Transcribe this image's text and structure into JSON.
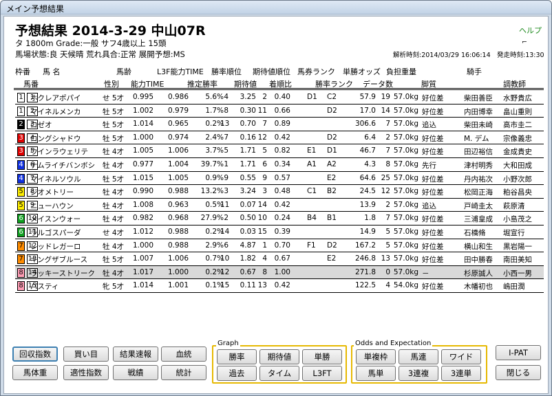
{
  "window": {
    "title": "メイン予想結果"
  },
  "header": {
    "title": "予想結果 2014-3-29 中山07R",
    "race_info": "タ 1800m  Grade:一般  サフ4歳以上  15頭",
    "conditions": "馬場状態:良    天候晴    荒れ具合:正常    展開予想:MS",
    "help": "ヘルプ",
    "analysis_time": "解析時刻:2014/03/29 16:06:14",
    "post_time": "発走時刻:13:30",
    "corner_icon": "⌐"
  },
  "columns_row1": {
    "waku": "枠番",
    "horse": "馬  名",
    "weight_label": "馬齢",
    "l3f": "L3F能力TIME",
    "win_rank": "勝率順位",
    "exp_rank": "期待値順位",
    "ticket_rank": "馬券ランク",
    "win_odds": "単勝オッズ",
    "burden": "負担重量",
    "jockey": "騎手"
  },
  "columns_row2": {
    "umaban": "馬番",
    "sex": "性別",
    "ability": "能力TIME",
    "est_win": "推定勝率",
    "expect": "期待値",
    "finish": "着順比",
    "win_rank2": "勝率ランク",
    "data_count": "データ数",
    "style": "脚質",
    "trainer": "調教師"
  },
  "rows": [
    {
      "waku": "1",
      "uma": "1",
      "name": "ホクレアポパイ",
      "sex": "せ 5才",
      "a1": "0.995",
      "a2": "0.986",
      "rate": "5.6%",
      "r1": "4",
      "exp": "3.25",
      "r2": "2",
      "fin": "0.40",
      "rk1": "D1",
      "rk2": "C2",
      "odds": "57.9",
      "cnt": "19",
      "wt": "57.0kg",
      "style": "好位差",
      "jockey": "柴田善臣",
      "trainer": "水野貴広"
    },
    {
      "waku": "1",
      "uma": "2",
      "name": "マイネルメンカ",
      "sex": "牡 5才",
      "a1": "1.002",
      "a2": "0.979",
      "rate": "1.7%",
      "r1": "8",
      "exp": "0.30",
      "r2": "11",
      "fin": "0.66",
      "rk1": "",
      "rk2": "D2",
      "odds": "17.0",
      "cnt": "14",
      "wt": "57.0kg",
      "style": "好位差",
      "jockey": "内田博幸",
      "trainer": "畠山重則"
    },
    {
      "waku": "2",
      "uma": "3",
      "name": "ロゼオ",
      "sex": "牡 5才",
      "a1": "1.014",
      "a2": "0.965",
      "rate": "0.2%",
      "r1": "13",
      "exp": "0.70",
      "r2": "7",
      "fin": "0.89",
      "rk1": "",
      "rk2": "",
      "odds": "306.6",
      "cnt": "7",
      "wt": "57.0kg",
      "style": "追込",
      "jockey": "柴田未崎",
      "trainer": "高市圭二"
    },
    {
      "waku": "3",
      "uma": "4",
      "name": "ロングシャドウ",
      "sex": "牡 5才",
      "a1": "1.000",
      "a2": "0.974",
      "rate": "2.4%",
      "r1": "7",
      "exp": "0.16",
      "r2": "12",
      "fin": "0.42",
      "rk1": "",
      "rk2": "D2",
      "odds": "6.4",
      "cnt": "2",
      "wt": "57.0kg",
      "style": "好位差",
      "jockey": "M. デム",
      "trainer": "宗像義忠"
    },
    {
      "waku": "3",
      "uma": "5",
      "name": "ウインラウェリテ",
      "sex": "牡 4才",
      "a1": "1.005",
      "a2": "1.006",
      "rate": "3.7%",
      "r1": "5",
      "exp": "1.71",
      "r2": "5",
      "fin": "0.82",
      "rk1": "E1",
      "rk2": "D1",
      "odds": "46.7",
      "cnt": "7",
      "wt": "57.0kg",
      "style": "好位差",
      "jockey": "田辺裕信",
      "trainer": "金成貴史"
    },
    {
      "waku": "4",
      "uma": "6",
      "name": "ナムライチバンボシ",
      "sex": "牡 4才",
      "a1": "0.977",
      "a2": "1.004",
      "rate": "39.7%",
      "r1": "1",
      "exp": "1.71",
      "r2": "6",
      "fin": "0.34",
      "rk1": "A1",
      "rk2": "A2",
      "odds": "4.3",
      "cnt": "8",
      "wt": "57.0kg",
      "style": "先行",
      "jockey": "津村明秀",
      "trainer": "大和田成"
    },
    {
      "waku": "4",
      "uma": "7",
      "name": "マイネルソウル",
      "sex": "牡 5才",
      "a1": "1.015",
      "a2": "1.005",
      "rate": "0.9%",
      "r1": "9",
      "exp": "0.55",
      "r2": "9",
      "fin": "0.57",
      "rk1": "",
      "rk2": "E2",
      "odds": "64.6",
      "cnt": "25",
      "wt": "57.0kg",
      "style": "好位差",
      "jockey": "丹内祐次",
      "trainer": "小野次郎"
    },
    {
      "waku": "5",
      "uma": "8",
      "name": "ジオメトリー",
      "sex": "牡 4才",
      "a1": "0.990",
      "a2": "0.988",
      "rate": "13.2%",
      "r1": "3",
      "exp": "3.24",
      "r2": "3",
      "fin": "0.48",
      "rk1": "C1",
      "rk2": "B2",
      "odds": "24.5",
      "cnt": "12",
      "wt": "57.0kg",
      "style": "好位差",
      "jockey": "松岡正海",
      "trainer": "粕谷昌央"
    },
    {
      "waku": "5",
      "uma": "9",
      "name": "ニューハウン",
      "sex": "牡 4才",
      "a1": "1.008",
      "a2": "0.963",
      "rate": "0.5%",
      "r1": "11",
      "exp": "0.07",
      "r2": "14",
      "fin": "0.42",
      "rk1": "",
      "rk2": "",
      "odds": "13.9",
      "cnt": "2",
      "wt": "57.0kg",
      "style": "追込",
      "jockey": "戸崎圭太",
      "trainer": "萩原清"
    },
    {
      "waku": "6",
      "uma": "10",
      "name": "メイスンウォー",
      "sex": "牡 4才",
      "a1": "0.982",
      "a2": "0.968",
      "rate": "27.9%",
      "r1": "2",
      "exp": "0.50",
      "r2": "10",
      "fin": "0.24",
      "rk1": "B4",
      "rk2": "B1",
      "odds": "1.8",
      "cnt": "7",
      "wt": "57.0kg",
      "style": "好位差",
      "jockey": "三浦皇成",
      "trainer": "小島茂之"
    },
    {
      "waku": "6",
      "uma": "11",
      "name": "ラルゴスパーダ",
      "sex": "せ 4才",
      "a1": "1.012",
      "a2": "0.988",
      "rate": "0.2%",
      "r1": "14",
      "exp": "0.03",
      "r2": "15",
      "fin": "0.39",
      "rk1": "",
      "rk2": "",
      "odds": "14.9",
      "cnt": "5",
      "wt": "57.0kg",
      "style": "好位差",
      "jockey": "石橋脩",
      "trainer": "堀宣行"
    },
    {
      "waku": "7",
      "uma": "12",
      "name": "レッドレガーロ",
      "sex": "牡 4才",
      "a1": "1.000",
      "a2": "0.988",
      "rate": "2.9%",
      "r1": "6",
      "exp": "4.87",
      "r2": "1",
      "fin": "0.70",
      "rk1": "F1",
      "rk2": "D2",
      "odds": "167.2",
      "cnt": "5",
      "wt": "57.0kg",
      "style": "好位差",
      "jockey": "横山和生",
      "trainer": "黒岩陽一"
    },
    {
      "waku": "7",
      "uma": "13",
      "name": "キングザブルース",
      "sex": "牡 5才",
      "a1": "1.007",
      "a2": "1.006",
      "rate": "0.7%",
      "r1": "10",
      "exp": "1.82",
      "r2": "4",
      "fin": "0.67",
      "rk1": "",
      "rk2": "E2",
      "odds": "246.8",
      "cnt": "13",
      "wt": "57.0kg",
      "style": "好位差",
      "jockey": "田中勝春",
      "trainer": "南田美知"
    },
    {
      "waku": "8",
      "uma": "14",
      "name": "ラッキーストリーク",
      "sex": "牡 4才",
      "a1": "1.017",
      "a2": "1.000",
      "rate": "0.2%",
      "r1": "12",
      "exp": "0.67",
      "r2": "8",
      "fin": "1.00",
      "rk1": "",
      "rk2": "",
      "odds": "271.8",
      "cnt": "0",
      "wt": "57.0kg",
      "style": "－",
      "jockey": "杉原誠人",
      "trainer": "小西一男"
    },
    {
      "waku": "8",
      "uma": "15",
      "name": "パスティ",
      "sex": "牝 5才",
      "a1": "1.014",
      "a2": "1.001",
      "rate": "0.1%",
      "r1": "15",
      "exp": "0.11",
      "r2": "13",
      "fin": "0.42",
      "rk1": "",
      "rk2": "",
      "odds": "122.5",
      "cnt": "4",
      "wt": "54.0kg",
      "style": "好位差",
      "jockey": "木幡初也",
      "trainer": "嶋田潤"
    }
  ],
  "waku_colors": {
    "1": {
      "bg": "#ffffff",
      "fg": "#000000"
    },
    "2": {
      "bg": "#000000",
      "fg": "#ffffff"
    },
    "3": {
      "bg": "#e00000",
      "fg": "#ffffff"
    },
    "4": {
      "bg": "#1030e0",
      "fg": "#ffffff"
    },
    "5": {
      "bg": "#ffee00",
      "fg": "#000000"
    },
    "6": {
      "bg": "#10a020",
      "fg": "#ffffff"
    },
    "7": {
      "bg": "#ff8c00",
      "fg": "#000000"
    },
    "8": {
      "bg": "#ff9db5",
      "fg": "#000000"
    }
  },
  "selected_row": 13,
  "buttons": {
    "recovery": "回収指数",
    "buy": "買い目",
    "result": "結果速報",
    "blood": "血統",
    "weight": "馬体重",
    "fitness": "適性指数",
    "record": "戦績",
    "stats": "統計",
    "graph_label": "Graph",
    "win_rate": "勝率",
    "expect": "期待値",
    "tansho": "単勝",
    "past": "過去",
    "time": "タイム",
    "l3ft": "L3FT",
    "odds_label": "Odds and Expectation",
    "fukusho": "単複枠",
    "umaren": "馬連",
    "wide": "ワイド",
    "umatan": "馬単",
    "sanrenpuku": "3連複",
    "sanrentan": "3連単",
    "ipat": "I-PAT",
    "close": "閉じる"
  }
}
